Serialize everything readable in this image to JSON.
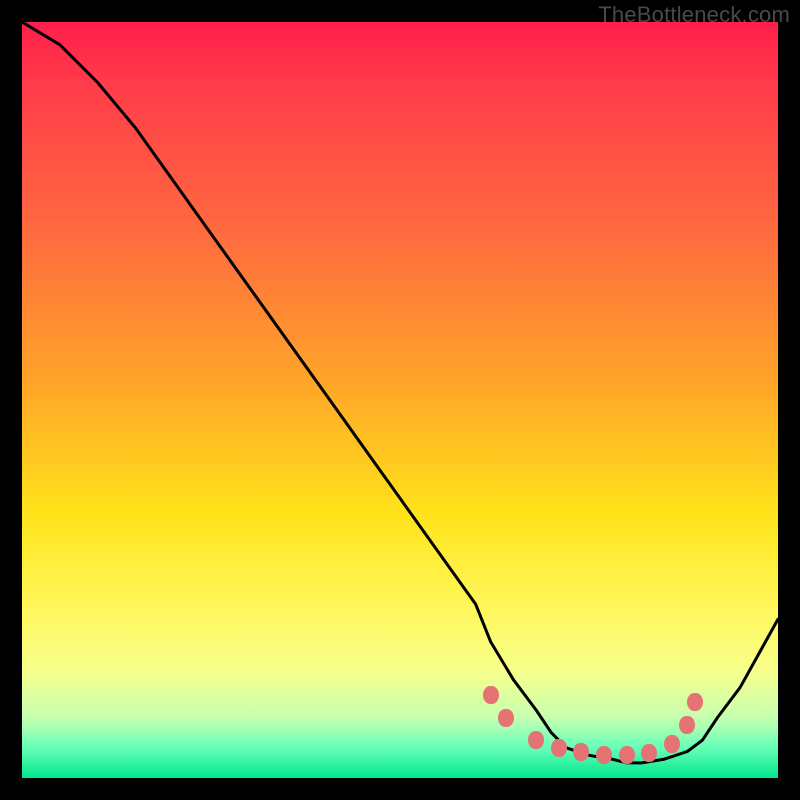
{
  "watermark": "TheBottleneck.com",
  "chart_data": {
    "type": "line",
    "title": "",
    "xlabel": "",
    "ylabel": "",
    "xlim": [
      0,
      100
    ],
    "ylim": [
      0,
      100
    ],
    "series": [
      {
        "name": "curve",
        "x": [
          0,
          5,
          10,
          15,
          20,
          25,
          30,
          35,
          40,
          45,
          50,
          55,
          60,
          62,
          65,
          68,
          70,
          72,
          75,
          78,
          80,
          82,
          85,
          88,
          90,
          92,
          95,
          100
        ],
        "y": [
          100,
          97,
          92,
          86,
          79,
          72,
          65,
          58,
          51,
          44,
          37,
          30,
          23,
          18,
          13,
          9,
          6,
          4,
          3,
          2.5,
          2,
          2,
          2.5,
          3.5,
          5,
          8,
          12,
          21
        ]
      }
    ],
    "markers": [
      {
        "x": 62,
        "y": 11
      },
      {
        "x": 64,
        "y": 8
      },
      {
        "x": 68,
        "y": 5
      },
      {
        "x": 71,
        "y": 4
      },
      {
        "x": 74,
        "y": 3.5
      },
      {
        "x": 77,
        "y": 3
      },
      {
        "x": 80,
        "y": 3
      },
      {
        "x": 83,
        "y": 3.3
      },
      {
        "x": 86,
        "y": 4.5
      },
      {
        "x": 88,
        "y": 7
      },
      {
        "x": 89,
        "y": 10
      }
    ],
    "background_gradient": {
      "top": "#ff1e4a",
      "bottom": "#00e68c",
      "stops": [
        "#ff1e4a",
        "#ff6b3f",
        "#ffa628",
        "#ffe31a",
        "#fff85e",
        "#c6ffb0",
        "#00e68c"
      ]
    }
  }
}
